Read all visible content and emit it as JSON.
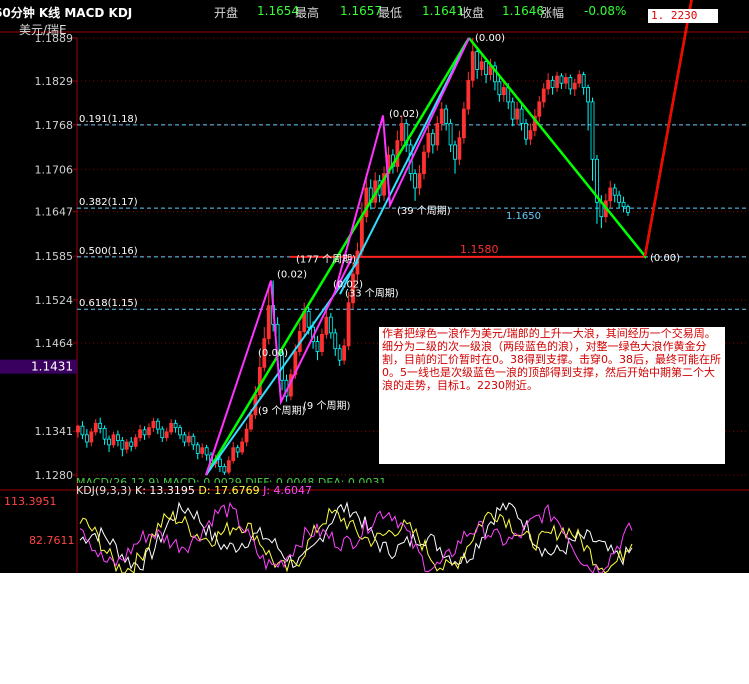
{
  "header": {
    "title": "60分钟 K线 MACD KDJ",
    "open_label": "开盘",
    "open_value": "1.1654",
    "high_label": "最高",
    "high_value": "1.1657",
    "low_label": "最低",
    "low_value": "1.1641",
    "close_label": "收盘",
    "close_value": "1.1646",
    "change_label": "涨幅",
    "change_value": "-0.08%",
    "target_box": "1. 2230"
  },
  "symbol": "美元/瑞E",
  "note": "作者把绿色一浪作为美元/瑞郎的上升一大浪，其间经历一个交易周。细分为二级的次一级浪（两段蓝色的浪），对整一绿色大浪作黄金分割，目前的汇价暂时在0。38得到支撑。击穿0。38后，最终可能在所0。5一线也是次级蓝色一浪的顶部得到支撑，然后开始中期第二个大浪的走势，目标1。2230附近。",
  "indicators": {
    "macd_line": "MACD(26,12,9) MACD: 0.0029 DIFF: 0.0048 DEA: 0.0031",
    "kdj_line_prefix": "KDJ(9,3,3)",
    "k_label": "K: 13.3195",
    "d_label": "D: 17.6769",
    "j_label": "J: 4.6047",
    "kdj_axis": [
      "113.3951",
      "82.7611"
    ]
  },
  "colors": {
    "bull": "#ff3030",
    "bear": "#00ffff",
    "grid": "#8b0000",
    "fib": "#5fd0ff",
    "wave_green": "#00ff00",
    "wave_blue": "#33ddff",
    "wave_magenta": "#ff33ff",
    "target_red": "#ff0000",
    "support_red": "#ff2020"
  },
  "chart_data": {
    "type": "candlestick",
    "y_ticks": [
      "1.1889",
      "1.1829",
      "1.1768",
      "1.1706",
      "1.1647",
      "1.1585",
      "1.1524",
      "1.1464",
      "1.1431",
      "1.1341",
      "1.1280"
    ],
    "current_price": "1.1431",
    "ylim": [
      1.128,
      1.1889
    ],
    "fib_levels": [
      {
        "label": "0.191(1.18)",
        "price": 1.1768
      },
      {
        "label": "0.382(1.17)",
        "price": 1.1652
      },
      {
        "label": "0.500(1.16)",
        "price": 1.1584
      },
      {
        "label": "0.618(1.15)",
        "price": 1.1511
      }
    ],
    "support": {
      "label": "1.1580",
      "price": 1.1584
    },
    "annotations": [
      {
        "text": "(0.00)",
        "price": 1.1885
      },
      {
        "text": "(0.02)",
        "price": 1.1779
      },
      {
        "text": "(39 个周期)",
        "price": 1.1644
      },
      {
        "text": "1.1650",
        "price": 1.1637
      },
      {
        "text": "(0.00)",
        "price": 1.1578
      },
      {
        "text": "(177 个周期)",
        "price": 1.1576
      },
      {
        "text": "(0.02)",
        "price": 1.1555
      },
      {
        "text": "(0.02)",
        "price": 1.1541
      },
      {
        "text": "(33 个周期)",
        "price": 1.1529
      },
      {
        "text": "(0.00)",
        "price": 1.1446
      },
      {
        "text": "(9 个周期)",
        "price": 1.1365
      },
      {
        "text": "(9 个周期)",
        "price": 1.1372
      }
    ],
    "waves": [
      {
        "color": "green",
        "points": [
          [
            206,
            1.128
          ],
          [
            469,
            1.1889
          ]
        ]
      },
      {
        "color": "green",
        "points": [
          [
            469,
            1.1889
          ],
          [
            645,
            1.1585
          ],
          [
            729,
            1.223
          ]
        ]
      },
      {
        "color": "blue",
        "points": [
          [
            206,
            1.128
          ],
          [
            358,
            1.1578
          ]
        ]
      },
      {
        "color": "blue",
        "points": [
          [
            340,
            1.1532
          ],
          [
            469,
            1.1889
          ]
        ]
      },
      {
        "color": "magenta",
        "points": [
          [
            206,
            1.128
          ],
          [
            271,
            1.1551
          ],
          [
            281,
            1.1382
          ],
          [
            352,
            1.1583
          ],
          [
            335,
            1.1535
          ],
          [
            383,
            1.1781
          ],
          [
            390,
            1.1656
          ],
          [
            469,
            1.1889
          ]
        ]
      },
      {
        "color": "red",
        "points": [
          [
            645,
            1.1585
          ],
          [
            729,
            1.223
          ]
        ]
      }
    ],
    "candles": [
      [
        1.134,
        1.1348,
        1.135,
        1.1332
      ],
      [
        1.1348,
        1.1336,
        1.1355,
        1.133
      ],
      [
        1.1336,
        1.1326,
        1.1344,
        1.1318
      ],
      [
        1.1326,
        1.134,
        1.1345,
        1.132
      ],
      [
        1.134,
        1.1352,
        1.1358,
        1.1335
      ],
      [
        1.1352,
        1.1345,
        1.136,
        1.1338
      ],
      [
        1.1345,
        1.133,
        1.1349,
        1.1322
      ],
      [
        1.133,
        1.1322,
        1.1335,
        1.1312
      ],
      [
        1.1322,
        1.1336,
        1.134,
        1.1318
      ],
      [
        1.1336,
        1.1328,
        1.1342,
        1.132
      ],
      [
        1.1328,
        1.1316,
        1.1333,
        1.1306
      ],
      [
        1.1316,
        1.1326,
        1.133,
        1.131
      ],
      [
        1.1326,
        1.132,
        1.1333,
        1.1313
      ],
      [
        1.132,
        1.1332,
        1.1337,
        1.1316
      ],
      [
        1.1332,
        1.1343,
        1.135,
        1.1327
      ],
      [
        1.1343,
        1.1336,
        1.1348,
        1.1329
      ],
      [
        1.1336,
        1.1346,
        1.1352,
        1.1331
      ],
      [
        1.1346,
        1.1355,
        1.136,
        1.134
      ],
      [
        1.1355,
        1.1344,
        1.1359,
        1.1337
      ],
      [
        1.1344,
        1.1332,
        1.1348,
        1.1326
      ],
      [
        1.1332,
        1.134,
        1.1346,
        1.1327
      ],
      [
        1.134,
        1.1352,
        1.1358,
        1.1336
      ],
      [
        1.1352,
        1.1346,
        1.1357,
        1.1339
      ],
      [
        1.1346,
        1.1336,
        1.135,
        1.133
      ],
      [
        1.1336,
        1.1326,
        1.134,
        1.132
      ],
      [
        1.1326,
        1.1334,
        1.134,
        1.132
      ],
      [
        1.1334,
        1.1322,
        1.1338,
        1.1315
      ],
      [
        1.1322,
        1.131,
        1.1326,
        1.1302
      ],
      [
        1.131,
        1.1318,
        1.1324,
        1.1304
      ],
      [
        1.1318,
        1.1308,
        1.1322,
        1.13
      ],
      [
        1.1308,
        1.1296,
        1.1312,
        1.1288
      ],
      [
        1.1296,
        1.1302,
        1.1308,
        1.129
      ],
      [
        1.1302,
        1.1292,
        1.1306,
        1.1284
      ],
      [
        1.1292,
        1.1284,
        1.1296,
        1.128
      ],
      [
        1.1284,
        1.13,
        1.1306,
        1.1281
      ],
      [
        1.13,
        1.1318,
        1.1326,
        1.1296
      ],
      [
        1.1318,
        1.1312,
        1.1322,
        1.1304
      ],
      [
        1.1312,
        1.1326,
        1.1332,
        1.1308
      ],
      [
        1.1326,
        1.1344,
        1.1352,
        1.132
      ],
      [
        1.1344,
        1.1364,
        1.1372,
        1.134
      ],
      [
        1.1364,
        1.1392,
        1.1404,
        1.1358
      ],
      [
        1.1392,
        1.143,
        1.1446,
        1.1386
      ],
      [
        1.143,
        1.147,
        1.1486,
        1.1424
      ],
      [
        1.147,
        1.1516,
        1.154,
        1.1462
      ],
      [
        1.1516,
        1.149,
        1.1551,
        1.148
      ],
      [
        1.149,
        1.145,
        1.15,
        1.1438
      ],
      [
        1.145,
        1.1412,
        1.1458,
        1.1398
      ],
      [
        1.1412,
        1.139,
        1.142,
        1.1382
      ],
      [
        1.139,
        1.142,
        1.1428,
        1.1384
      ],
      [
        1.142,
        1.1452,
        1.1462,
        1.1414
      ],
      [
        1.1452,
        1.148,
        1.1492,
        1.1446
      ],
      [
        1.148,
        1.1508,
        1.152,
        1.1472
      ],
      [
        1.1508,
        1.1486,
        1.1514,
        1.1476
      ],
      [
        1.1486,
        1.1466,
        1.1494,
        1.1456
      ],
      [
        1.1466,
        1.1452,
        1.1474,
        1.144
      ],
      [
        1.1452,
        1.1476,
        1.1484,
        1.1446
      ],
      [
        1.1476,
        1.15,
        1.1512,
        1.147
      ],
      [
        1.15,
        1.1478,
        1.1506,
        1.147
      ],
      [
        1.1478,
        1.1456,
        1.1484,
        1.1446
      ],
      [
        1.1456,
        1.144,
        1.1462,
        1.1432
      ],
      [
        1.144,
        1.146,
        1.147,
        1.1434
      ],
      [
        1.146,
        1.152,
        1.1535,
        1.1454
      ],
      [
        1.152,
        1.156,
        1.1576,
        1.1512
      ],
      [
        1.156,
        1.1592,
        1.1604,
        1.155
      ],
      [
        1.1592,
        1.164,
        1.166,
        1.1584
      ],
      [
        1.164,
        1.168,
        1.17,
        1.1632
      ],
      [
        1.168,
        1.166,
        1.1692,
        1.165
      ],
      [
        1.166,
        1.169,
        1.1702,
        1.1652
      ],
      [
        1.169,
        1.167,
        1.1698,
        1.166
      ],
      [
        1.167,
        1.17,
        1.171,
        1.1662
      ],
      [
        1.17,
        1.1726,
        1.1738,
        1.1692
      ],
      [
        1.1726,
        1.171,
        1.1734,
        1.17
      ],
      [
        1.171,
        1.1746,
        1.176,
        1.1702
      ],
      [
        1.1746,
        1.177,
        1.1781,
        1.1738
      ],
      [
        1.177,
        1.174,
        1.1776,
        1.173
      ],
      [
        1.174,
        1.17,
        1.1748,
        1.169
      ],
      [
        1.17,
        1.168,
        1.1706,
        1.1662
      ],
      [
        1.168,
        1.17,
        1.1712,
        1.167
      ],
      [
        1.17,
        1.173,
        1.174,
        1.1692
      ],
      [
        1.173,
        1.1756,
        1.1766,
        1.1722
      ],
      [
        1.1756,
        1.174,
        1.1762,
        1.1728
      ],
      [
        1.174,
        1.177,
        1.178,
        1.1732
      ],
      [
        1.177,
        1.179,
        1.18,
        1.176
      ],
      [
        1.179,
        1.177,
        1.1796,
        1.176
      ],
      [
        1.177,
        1.174,
        1.1776,
        1.173
      ],
      [
        1.174,
        1.172,
        1.1746,
        1.17
      ],
      [
        1.172,
        1.175,
        1.176,
        1.1712
      ],
      [
        1.175,
        1.179,
        1.18,
        1.1742
      ],
      [
        1.179,
        1.183,
        1.1842,
        1.1782
      ],
      [
        1.183,
        1.187,
        1.1889,
        1.182
      ],
      [
        1.187,
        1.1845,
        1.1876,
        1.1832
      ],
      [
        1.1845,
        1.1856,
        1.1866,
        1.1836
      ],
      [
        1.1856,
        1.1838,
        1.1862,
        1.1826
      ],
      [
        1.1838,
        1.185,
        1.186,
        1.183
      ],
      [
        1.185,
        1.1828,
        1.1856,
        1.1816
      ],
      [
        1.1828,
        1.181,
        1.1834,
        1.18
      ],
      [
        1.181,
        1.182,
        1.183,
        1.18
      ],
      [
        1.182,
        1.18,
        1.1826,
        1.179
      ],
      [
        1.18,
        1.1776,
        1.1806,
        1.1766
      ],
      [
        1.1776,
        1.179,
        1.18,
        1.1768
      ],
      [
        1.179,
        1.177,
        1.1796,
        1.176
      ],
      [
        1.177,
        1.1748,
        1.1776,
        1.174
      ],
      [
        1.1748,
        1.176,
        1.177,
        1.174
      ],
      [
        1.176,
        1.178,
        1.179,
        1.1752
      ],
      [
        1.178,
        1.18,
        1.1808,
        1.1772
      ],
      [
        1.18,
        1.1818,
        1.1826,
        1.1792
      ],
      [
        1.1818,
        1.183,
        1.184,
        1.181
      ],
      [
        1.183,
        1.182,
        1.1836,
        1.181
      ],
      [
        1.182,
        1.1836,
        1.1842,
        1.1814
      ],
      [
        1.1836,
        1.1826,
        1.184,
        1.1818
      ],
      [
        1.1826,
        1.1834,
        1.184,
        1.1818
      ],
      [
        1.1834,
        1.1818,
        1.1838,
        1.181
      ],
      [
        1.1818,
        1.1826,
        1.1832,
        1.1808
      ],
      [
        1.1826,
        1.1838,
        1.1844,
        1.182
      ],
      [
        1.1838,
        1.182,
        1.1842,
        1.181
      ],
      [
        1.182,
        1.18,
        1.1824,
        1.176
      ],
      [
        1.18,
        1.172,
        1.1806,
        1.169
      ],
      [
        1.172,
        1.166,
        1.1726,
        1.163
      ],
      [
        1.166,
        1.164,
        1.167,
        1.1624
      ],
      [
        1.164,
        1.1662,
        1.1672,
        1.1632
      ],
      [
        1.1662,
        1.168,
        1.169,
        1.1652
      ],
      [
        1.168,
        1.167,
        1.1686,
        1.166
      ],
      [
        1.167,
        1.166,
        1.1676,
        1.1652
      ],
      [
        1.166,
        1.1654,
        1.1668,
        1.1646
      ],
      [
        1.1654,
        1.1646,
        1.1657,
        1.1641
      ]
    ]
  }
}
